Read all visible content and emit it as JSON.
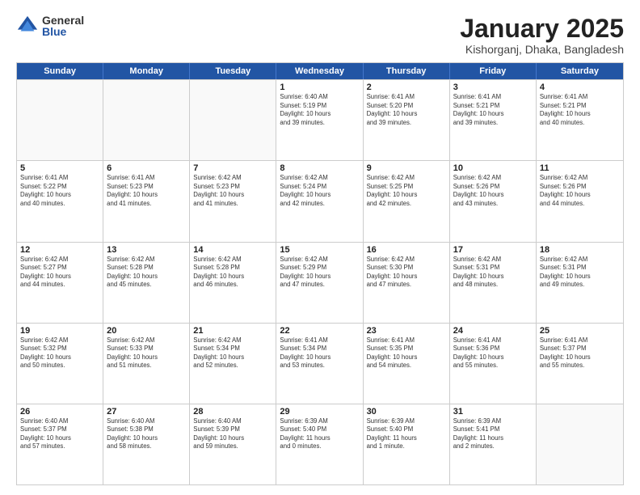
{
  "logo": {
    "general": "General",
    "blue": "Blue"
  },
  "title": "January 2025",
  "subtitle": "Kishorganj, Dhaka, Bangladesh",
  "days": [
    "Sunday",
    "Monday",
    "Tuesday",
    "Wednesday",
    "Thursday",
    "Friday",
    "Saturday"
  ],
  "weeks": [
    [
      {
        "num": "",
        "info": ""
      },
      {
        "num": "",
        "info": ""
      },
      {
        "num": "",
        "info": ""
      },
      {
        "num": "1",
        "info": "Sunrise: 6:40 AM\nSunset: 5:19 PM\nDaylight: 10 hours\nand 39 minutes."
      },
      {
        "num": "2",
        "info": "Sunrise: 6:41 AM\nSunset: 5:20 PM\nDaylight: 10 hours\nand 39 minutes."
      },
      {
        "num": "3",
        "info": "Sunrise: 6:41 AM\nSunset: 5:21 PM\nDaylight: 10 hours\nand 39 minutes."
      },
      {
        "num": "4",
        "info": "Sunrise: 6:41 AM\nSunset: 5:21 PM\nDaylight: 10 hours\nand 40 minutes."
      }
    ],
    [
      {
        "num": "5",
        "info": "Sunrise: 6:41 AM\nSunset: 5:22 PM\nDaylight: 10 hours\nand 40 minutes."
      },
      {
        "num": "6",
        "info": "Sunrise: 6:41 AM\nSunset: 5:23 PM\nDaylight: 10 hours\nand 41 minutes."
      },
      {
        "num": "7",
        "info": "Sunrise: 6:42 AM\nSunset: 5:23 PM\nDaylight: 10 hours\nand 41 minutes."
      },
      {
        "num": "8",
        "info": "Sunrise: 6:42 AM\nSunset: 5:24 PM\nDaylight: 10 hours\nand 42 minutes."
      },
      {
        "num": "9",
        "info": "Sunrise: 6:42 AM\nSunset: 5:25 PM\nDaylight: 10 hours\nand 42 minutes."
      },
      {
        "num": "10",
        "info": "Sunrise: 6:42 AM\nSunset: 5:26 PM\nDaylight: 10 hours\nand 43 minutes."
      },
      {
        "num": "11",
        "info": "Sunrise: 6:42 AM\nSunset: 5:26 PM\nDaylight: 10 hours\nand 44 minutes."
      }
    ],
    [
      {
        "num": "12",
        "info": "Sunrise: 6:42 AM\nSunset: 5:27 PM\nDaylight: 10 hours\nand 44 minutes."
      },
      {
        "num": "13",
        "info": "Sunrise: 6:42 AM\nSunset: 5:28 PM\nDaylight: 10 hours\nand 45 minutes."
      },
      {
        "num": "14",
        "info": "Sunrise: 6:42 AM\nSunset: 5:28 PM\nDaylight: 10 hours\nand 46 minutes."
      },
      {
        "num": "15",
        "info": "Sunrise: 6:42 AM\nSunset: 5:29 PM\nDaylight: 10 hours\nand 47 minutes."
      },
      {
        "num": "16",
        "info": "Sunrise: 6:42 AM\nSunset: 5:30 PM\nDaylight: 10 hours\nand 47 minutes."
      },
      {
        "num": "17",
        "info": "Sunrise: 6:42 AM\nSunset: 5:31 PM\nDaylight: 10 hours\nand 48 minutes."
      },
      {
        "num": "18",
        "info": "Sunrise: 6:42 AM\nSunset: 5:31 PM\nDaylight: 10 hours\nand 49 minutes."
      }
    ],
    [
      {
        "num": "19",
        "info": "Sunrise: 6:42 AM\nSunset: 5:32 PM\nDaylight: 10 hours\nand 50 minutes."
      },
      {
        "num": "20",
        "info": "Sunrise: 6:42 AM\nSunset: 5:33 PM\nDaylight: 10 hours\nand 51 minutes."
      },
      {
        "num": "21",
        "info": "Sunrise: 6:42 AM\nSunset: 5:34 PM\nDaylight: 10 hours\nand 52 minutes."
      },
      {
        "num": "22",
        "info": "Sunrise: 6:41 AM\nSunset: 5:34 PM\nDaylight: 10 hours\nand 53 minutes."
      },
      {
        "num": "23",
        "info": "Sunrise: 6:41 AM\nSunset: 5:35 PM\nDaylight: 10 hours\nand 54 minutes."
      },
      {
        "num": "24",
        "info": "Sunrise: 6:41 AM\nSunset: 5:36 PM\nDaylight: 10 hours\nand 55 minutes."
      },
      {
        "num": "25",
        "info": "Sunrise: 6:41 AM\nSunset: 5:37 PM\nDaylight: 10 hours\nand 55 minutes."
      }
    ],
    [
      {
        "num": "26",
        "info": "Sunrise: 6:40 AM\nSunset: 5:37 PM\nDaylight: 10 hours\nand 57 minutes."
      },
      {
        "num": "27",
        "info": "Sunrise: 6:40 AM\nSunset: 5:38 PM\nDaylight: 10 hours\nand 58 minutes."
      },
      {
        "num": "28",
        "info": "Sunrise: 6:40 AM\nSunset: 5:39 PM\nDaylight: 10 hours\nand 59 minutes."
      },
      {
        "num": "29",
        "info": "Sunrise: 6:39 AM\nSunset: 5:40 PM\nDaylight: 11 hours\nand 0 minutes."
      },
      {
        "num": "30",
        "info": "Sunrise: 6:39 AM\nSunset: 5:40 PM\nDaylight: 11 hours\nand 1 minute."
      },
      {
        "num": "31",
        "info": "Sunrise: 6:39 AM\nSunset: 5:41 PM\nDaylight: 11 hours\nand 2 minutes."
      },
      {
        "num": "",
        "info": ""
      }
    ]
  ]
}
